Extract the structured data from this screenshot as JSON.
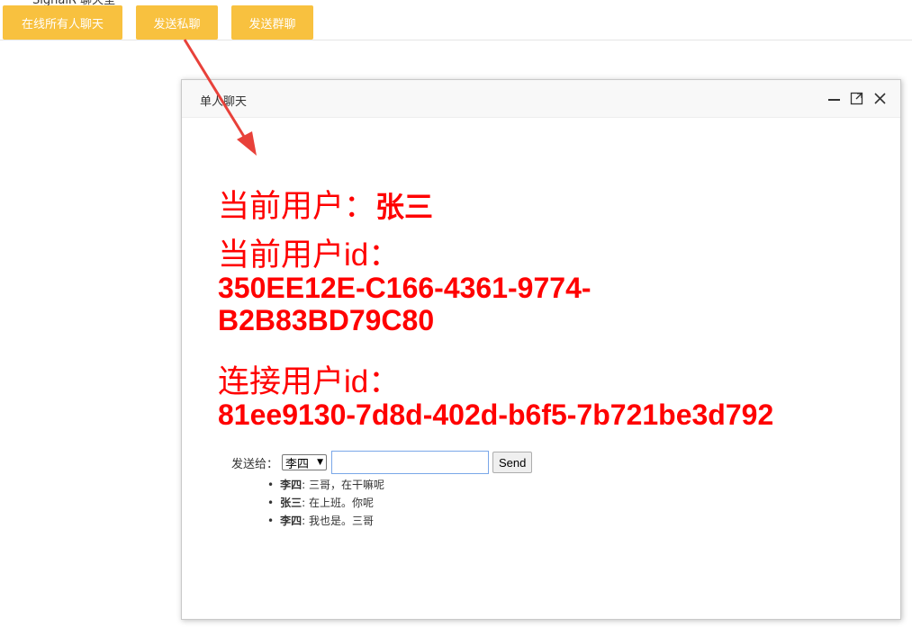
{
  "page": {
    "title": "SignalR 聊天室"
  },
  "toolbar": {
    "chat_all_label": "在线所有人聊天",
    "private_label": "发送私聊",
    "group_label": "发送群聊"
  },
  "dialog": {
    "title": "单人聊天",
    "current_user_label": "当前用户：",
    "current_user_name": "张三",
    "current_user_id_label": "当前用户id：",
    "current_user_id_line1": "350EE12E-C166-4361-9774-",
    "current_user_id_line2": "B2B83BD79C80",
    "connection_id_label": "连接用户id：",
    "connection_id": "81ee9130-7d8d-402d-b6f5-7b721be3d792",
    "send_to_label": "发送给：",
    "send_to_selected": "李四",
    "message_value": "",
    "send_button": "Send",
    "messages": [
      {
        "sender": "李四",
        "text": ": 三哥，在干嘛呢"
      },
      {
        "sender": "张三",
        "text": ": 在上班。你呢"
      },
      {
        "sender": "李四",
        "text": ": 我也是。三哥"
      }
    ]
  },
  "colors": {
    "accent": "#f8c13f",
    "info_text": "#ff0000",
    "arrow": "#e8413a"
  },
  "icons": {
    "minimize": "minimize-icon",
    "maximize": "maximize-icon",
    "close": "close-icon",
    "dropdown": "caret-down-icon"
  }
}
